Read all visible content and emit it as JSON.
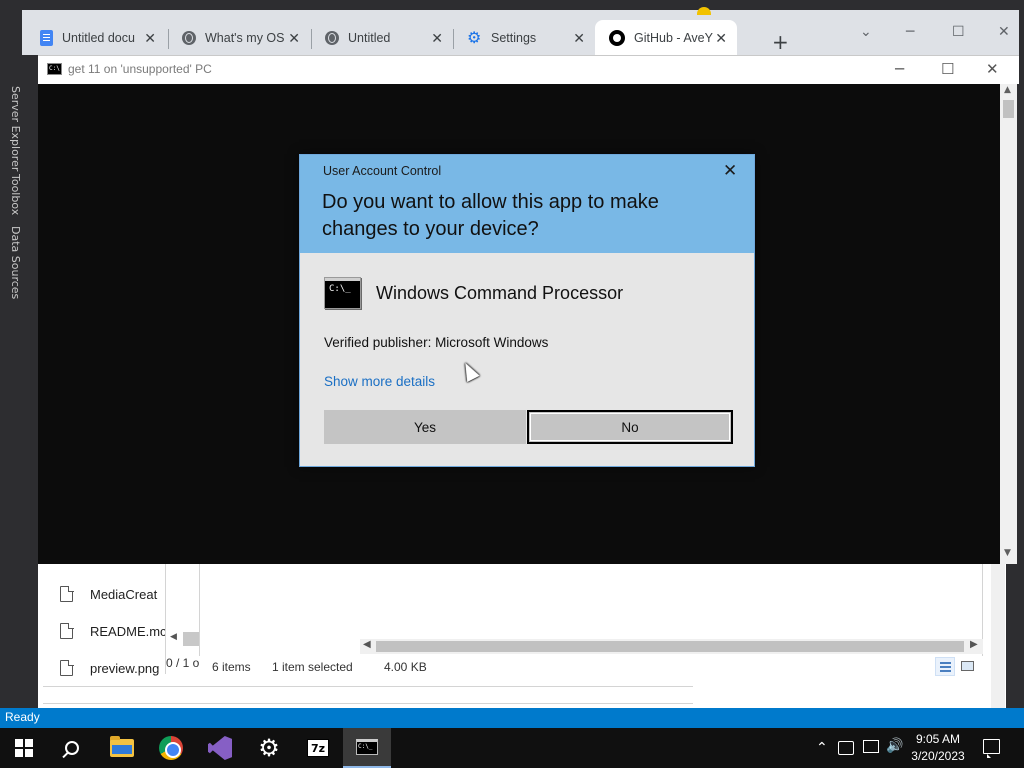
{
  "chrome": {
    "tabs": [
      {
        "title": "Untitled docu",
        "icon": "google-docs-icon",
        "active": false
      },
      {
        "title": "What's my OS",
        "icon": "globe-icon",
        "active": false
      },
      {
        "title": "Untitled",
        "icon": "globe-icon",
        "active": false
      },
      {
        "title": "Settings",
        "icon": "gear-icon",
        "active": false
      },
      {
        "title": "GitHub - AveY",
        "icon": "github-icon",
        "active": true
      }
    ],
    "new_tab": "+",
    "close_glyph": "✕"
  },
  "vs": {
    "rail_labels": [
      "Server Explorer",
      "Toolbox",
      "Data Sources"
    ],
    "status": "Ready"
  },
  "cmd_window": {
    "title": "get 11 on 'unsupported' PC",
    "icon_text": "C:\\"
  },
  "explorer": {
    "files": [
      "MediaCreat",
      "README.mc",
      "preview.png"
    ],
    "mid_status": "0 / 1 o",
    "status_items": "6 items",
    "status_selected": "1 item selected",
    "status_size": "4.00 KB"
  },
  "uac": {
    "header": "User Account Control",
    "question": "Do you want to allow this app to make changes to your device?",
    "app_name": "Windows Command Processor",
    "app_icon_text": "C:\\_",
    "publisher": "Verified publisher: Microsoft Windows",
    "details_link": "Show more details",
    "yes": "Yes",
    "no": "No",
    "accent_color": "#79b8e6",
    "link_color": "#1a6fc4"
  },
  "taskbar": {
    "items": [
      "start-button",
      "search",
      "file-explorer",
      "chrome",
      "visual-studio",
      "settings",
      "7zip",
      "command-prompt"
    ],
    "seven_zip_label": "7z",
    "cmd_icon_text": "C:\\_",
    "time": "9:05 AM",
    "date": "3/20/2023",
    "tray_up": "⌃",
    "volume": "🔊"
  }
}
